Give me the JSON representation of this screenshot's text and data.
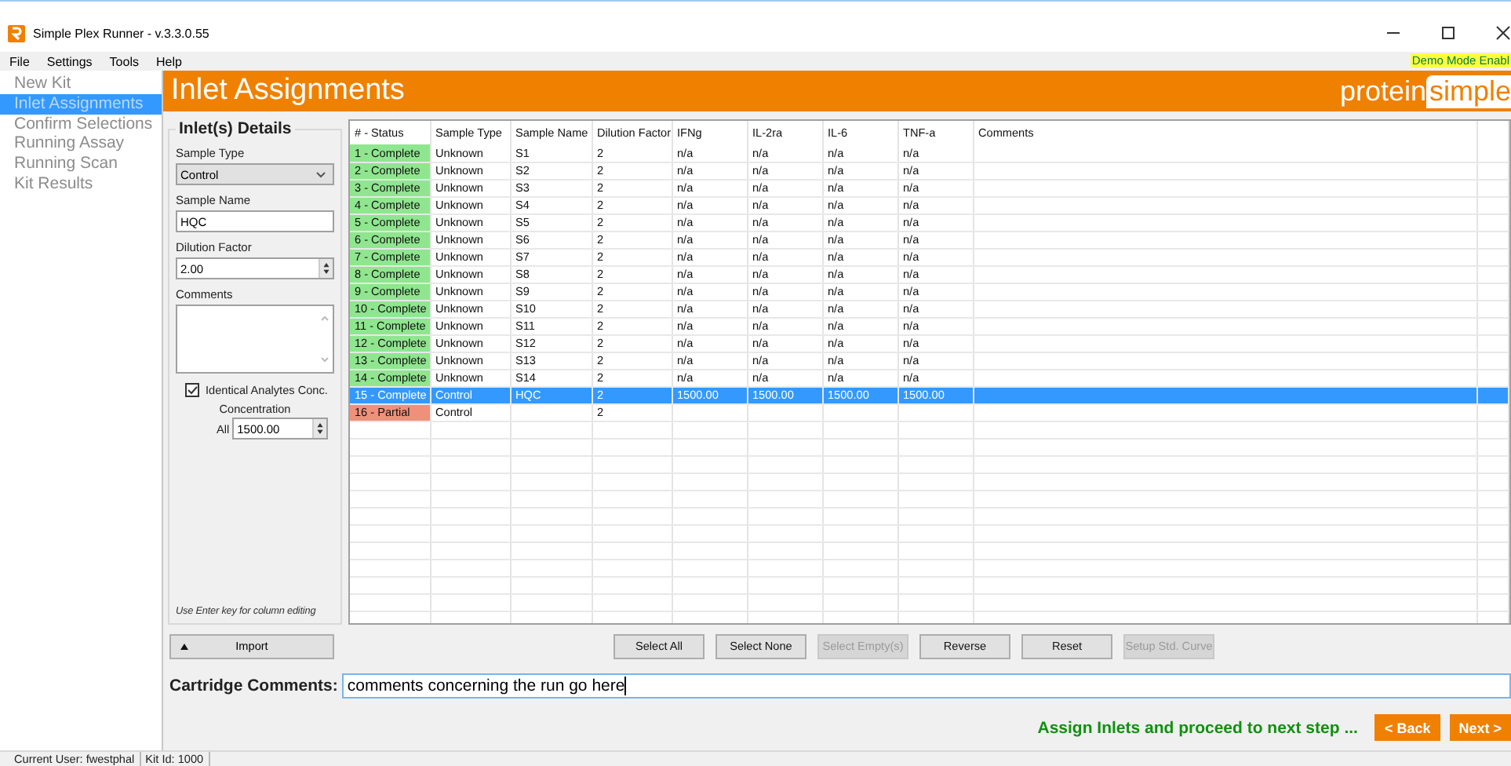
{
  "window": {
    "title": "Simple Plex Runner - v.3.3.0.55"
  },
  "menu": [
    "File",
    "Settings",
    "Tools",
    "Help"
  ],
  "demo_badge": "Demo Mode Enabl",
  "nav": [
    {
      "label": "New Kit",
      "selected": false
    },
    {
      "label": "Inlet Assignments",
      "selected": true
    },
    {
      "label": "Confirm Selections",
      "selected": false
    },
    {
      "label": "Running Assay",
      "selected": false
    },
    {
      "label": "Running Scan",
      "selected": false
    },
    {
      "label": "Kit Results",
      "selected": false
    }
  ],
  "header": {
    "title": "Inlet Assignments",
    "logo_left": "protein",
    "logo_right": "simple"
  },
  "details": {
    "legend": "Inlet(s) Details",
    "sample_type_label": "Sample Type",
    "sample_type_value": "Control",
    "sample_name_label": "Sample Name",
    "sample_name_value": "HQC",
    "dilution_label": "Dilution Factor",
    "dilution_value": "2.00",
    "comments_label": "Comments",
    "identical": {
      "label": "Identical Analytes Conc.",
      "checked": true
    },
    "concentration_label": "Concentration",
    "all_label": "All",
    "concentration_value": "1500.00",
    "hint": "Use Enter key for column editing"
  },
  "import_button": "Import",
  "table": {
    "columns": [
      "# - Status",
      "Sample Type",
      "Sample Name",
      "Dilution Factor",
      "IFNg",
      "IL-2ra",
      "IL-6",
      "TNF-a",
      "Comments"
    ],
    "rows": [
      {
        "kind": "complete",
        "selected": false,
        "cells": [
          "1 - Complete",
          "Unknown",
          "S1",
          "2",
          "n/a",
          "n/a",
          "n/a",
          "n/a"
        ]
      },
      {
        "kind": "complete",
        "selected": false,
        "cells": [
          "2 - Complete",
          "Unknown",
          "S2",
          "2",
          "n/a",
          "n/a",
          "n/a",
          "n/a"
        ]
      },
      {
        "kind": "complete",
        "selected": false,
        "cells": [
          "3 - Complete",
          "Unknown",
          "S3",
          "2",
          "n/a",
          "n/a",
          "n/a",
          "n/a"
        ]
      },
      {
        "kind": "complete",
        "selected": false,
        "cells": [
          "4 - Complete",
          "Unknown",
          "S4",
          "2",
          "n/a",
          "n/a",
          "n/a",
          "n/a"
        ]
      },
      {
        "kind": "complete",
        "selected": false,
        "cells": [
          "5 - Complete",
          "Unknown",
          "S5",
          "2",
          "n/a",
          "n/a",
          "n/a",
          "n/a"
        ]
      },
      {
        "kind": "complete",
        "selected": false,
        "cells": [
          "6 - Complete",
          "Unknown",
          "S6",
          "2",
          "n/a",
          "n/a",
          "n/a",
          "n/a"
        ]
      },
      {
        "kind": "complete",
        "selected": false,
        "cells": [
          "7 - Complete",
          "Unknown",
          "S7",
          "2",
          "n/a",
          "n/a",
          "n/a",
          "n/a"
        ]
      },
      {
        "kind": "complete",
        "selected": false,
        "cells": [
          "8 - Complete",
          "Unknown",
          "S8",
          "2",
          "n/a",
          "n/a",
          "n/a",
          "n/a"
        ]
      },
      {
        "kind": "complete",
        "selected": false,
        "cells": [
          "9 - Complete",
          "Unknown",
          "S9",
          "2",
          "n/a",
          "n/a",
          "n/a",
          "n/a"
        ]
      },
      {
        "kind": "complete",
        "selected": false,
        "cells": [
          "10 - Complete",
          "Unknown",
          "S10",
          "2",
          "n/a",
          "n/a",
          "n/a",
          "n/a"
        ]
      },
      {
        "kind": "complete",
        "selected": false,
        "cells": [
          "11 - Complete",
          "Unknown",
          "S11",
          "2",
          "n/a",
          "n/a",
          "n/a",
          "n/a"
        ]
      },
      {
        "kind": "complete",
        "selected": false,
        "cells": [
          "12 - Complete",
          "Unknown",
          "S12",
          "2",
          "n/a",
          "n/a",
          "n/a",
          "n/a"
        ]
      },
      {
        "kind": "complete",
        "selected": false,
        "cells": [
          "13 - Complete",
          "Unknown",
          "S13",
          "2",
          "n/a",
          "n/a",
          "n/a",
          "n/a"
        ]
      },
      {
        "kind": "complete",
        "selected": false,
        "cells": [
          "14 - Complete",
          "Unknown",
          "S14",
          "2",
          "n/a",
          "n/a",
          "n/a",
          "n/a"
        ]
      },
      {
        "selected": true,
        "cells": [
          "15 - Complete",
          "Control",
          "HQC",
          "2",
          "1500.00",
          "1500.00",
          "1500.00",
          "1500.00"
        ]
      },
      {
        "kind": "partial",
        "selected": false,
        "cells": [
          "16 - Partial",
          "Control",
          null,
          "2"
        ]
      }
    ]
  },
  "buttons": [
    {
      "label": "Select All",
      "disabled": false
    },
    {
      "label": "Select None",
      "disabled": false
    },
    {
      "label": "Select Empty(s)",
      "disabled": true
    },
    {
      "label": "Reverse",
      "disabled": false
    },
    {
      "label": "Reset",
      "disabled": false
    },
    {
      "label": "Setup Std. Curve",
      "disabled": true
    }
  ],
  "cartridge": {
    "label": "Cartridge Comments:",
    "value": "comments concerning the run go here"
  },
  "footer": {
    "message": "Assign Inlets and proceed to next step ...",
    "back": "< Back",
    "next": "Next >"
  },
  "status_bar": [
    "Current User: fwestphal",
    "Kit Id: 1000"
  ]
}
